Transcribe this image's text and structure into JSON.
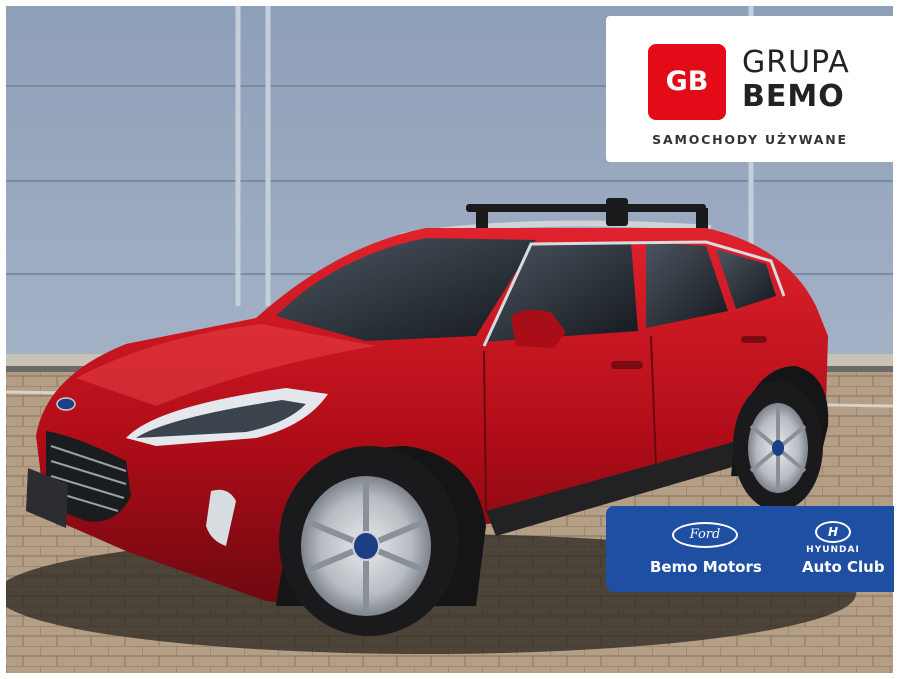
{
  "logo": {
    "badge": "GB",
    "line1": "GRUPA",
    "line2": "BEMO",
    "subtitle": "SAMOCHODY UŻYWANE",
    "badge_color": "#e30b17"
  },
  "dealers": {
    "ford_logo_text": "Ford",
    "ford_dealer": "Bemo Motors",
    "hyundai_logo_text": "HYUNDAI",
    "hyundai_dealer": "Auto Club",
    "panel_color": "#1f4fa3"
  },
  "photo": {
    "subject": "red Ford Kuga SUV parked on a paved lot",
    "car_color": "#c8101e"
  }
}
